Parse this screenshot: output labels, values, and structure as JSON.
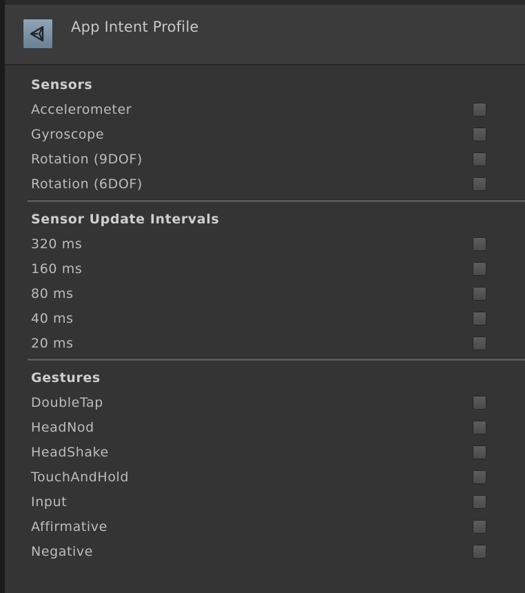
{
  "header": {
    "title": "App Intent Profile",
    "icon": "unity-logo-icon"
  },
  "sections": [
    {
      "title": "Sensors",
      "items": [
        {
          "label": "Accelerometer",
          "checked": false
        },
        {
          "label": "Gyroscope",
          "checked": false
        },
        {
          "label": "Rotation (9DOF)",
          "checked": false
        },
        {
          "label": "Rotation (6DOF)",
          "checked": false
        }
      ]
    },
    {
      "title": "Sensor Update Intervals",
      "items": [
        {
          "label": "320 ms",
          "checked": false
        },
        {
          "label": "160 ms",
          "checked": false
        },
        {
          "label": "80 ms",
          "checked": false
        },
        {
          "label": "40 ms",
          "checked": false
        },
        {
          "label": "20 ms",
          "checked": false
        }
      ]
    },
    {
      "title": "Gestures",
      "items": [
        {
          "label": "DoubleTap",
          "checked": false
        },
        {
          "label": "HeadNod",
          "checked": false
        },
        {
          "label": "HeadShake",
          "checked": false
        },
        {
          "label": "TouchAndHold",
          "checked": false
        },
        {
          "label": "Input",
          "checked": false
        },
        {
          "label": "Affirmative",
          "checked": false
        },
        {
          "label": "Negative",
          "checked": false
        }
      ]
    }
  ]
}
